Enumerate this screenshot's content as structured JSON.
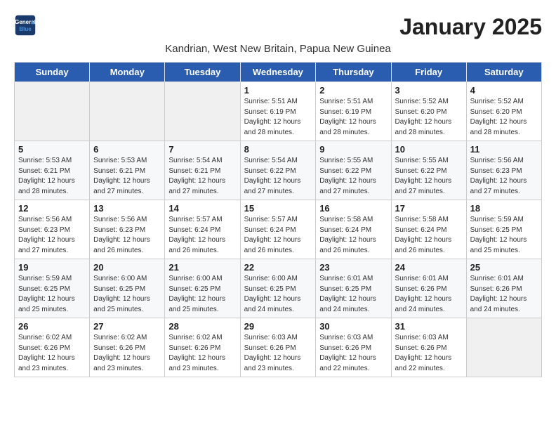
{
  "logo": {
    "line1": "General",
    "line2": "Blue"
  },
  "title": "January 2025",
  "subtitle": "Kandrian, West New Britain, Papua New Guinea",
  "days_of_week": [
    "Sunday",
    "Monday",
    "Tuesday",
    "Wednesday",
    "Thursday",
    "Friday",
    "Saturday"
  ],
  "weeks": [
    [
      {
        "day": "",
        "sunrise": "",
        "sunset": "",
        "daylight": ""
      },
      {
        "day": "",
        "sunrise": "",
        "sunset": "",
        "daylight": ""
      },
      {
        "day": "",
        "sunrise": "",
        "sunset": "",
        "daylight": ""
      },
      {
        "day": "1",
        "sunrise": "Sunrise: 5:51 AM",
        "sunset": "Sunset: 6:19 PM",
        "daylight": "Daylight: 12 hours and 28 minutes."
      },
      {
        "day": "2",
        "sunrise": "Sunrise: 5:51 AM",
        "sunset": "Sunset: 6:19 PM",
        "daylight": "Daylight: 12 hours and 28 minutes."
      },
      {
        "day": "3",
        "sunrise": "Sunrise: 5:52 AM",
        "sunset": "Sunset: 6:20 PM",
        "daylight": "Daylight: 12 hours and 28 minutes."
      },
      {
        "day": "4",
        "sunrise": "Sunrise: 5:52 AM",
        "sunset": "Sunset: 6:20 PM",
        "daylight": "Daylight: 12 hours and 28 minutes."
      }
    ],
    [
      {
        "day": "5",
        "sunrise": "Sunrise: 5:53 AM",
        "sunset": "Sunset: 6:21 PM",
        "daylight": "Daylight: 12 hours and 28 minutes."
      },
      {
        "day": "6",
        "sunrise": "Sunrise: 5:53 AM",
        "sunset": "Sunset: 6:21 PM",
        "daylight": "Daylight: 12 hours and 27 minutes."
      },
      {
        "day": "7",
        "sunrise": "Sunrise: 5:54 AM",
        "sunset": "Sunset: 6:21 PM",
        "daylight": "Daylight: 12 hours and 27 minutes."
      },
      {
        "day": "8",
        "sunrise": "Sunrise: 5:54 AM",
        "sunset": "Sunset: 6:22 PM",
        "daylight": "Daylight: 12 hours and 27 minutes."
      },
      {
        "day": "9",
        "sunrise": "Sunrise: 5:55 AM",
        "sunset": "Sunset: 6:22 PM",
        "daylight": "Daylight: 12 hours and 27 minutes."
      },
      {
        "day": "10",
        "sunrise": "Sunrise: 5:55 AM",
        "sunset": "Sunset: 6:22 PM",
        "daylight": "Daylight: 12 hours and 27 minutes."
      },
      {
        "day": "11",
        "sunrise": "Sunrise: 5:56 AM",
        "sunset": "Sunset: 6:23 PM",
        "daylight": "Daylight: 12 hours and 27 minutes."
      }
    ],
    [
      {
        "day": "12",
        "sunrise": "Sunrise: 5:56 AM",
        "sunset": "Sunset: 6:23 PM",
        "daylight": "Daylight: 12 hours and 27 minutes."
      },
      {
        "day": "13",
        "sunrise": "Sunrise: 5:56 AM",
        "sunset": "Sunset: 6:23 PM",
        "daylight": "Daylight: 12 hours and 26 minutes."
      },
      {
        "day": "14",
        "sunrise": "Sunrise: 5:57 AM",
        "sunset": "Sunset: 6:24 PM",
        "daylight": "Daylight: 12 hours and 26 minutes."
      },
      {
        "day": "15",
        "sunrise": "Sunrise: 5:57 AM",
        "sunset": "Sunset: 6:24 PM",
        "daylight": "Daylight: 12 hours and 26 minutes."
      },
      {
        "day": "16",
        "sunrise": "Sunrise: 5:58 AM",
        "sunset": "Sunset: 6:24 PM",
        "daylight": "Daylight: 12 hours and 26 minutes."
      },
      {
        "day": "17",
        "sunrise": "Sunrise: 5:58 AM",
        "sunset": "Sunset: 6:24 PM",
        "daylight": "Daylight: 12 hours and 26 minutes."
      },
      {
        "day": "18",
        "sunrise": "Sunrise: 5:59 AM",
        "sunset": "Sunset: 6:25 PM",
        "daylight": "Daylight: 12 hours and 25 minutes."
      }
    ],
    [
      {
        "day": "19",
        "sunrise": "Sunrise: 5:59 AM",
        "sunset": "Sunset: 6:25 PM",
        "daylight": "Daylight: 12 hours and 25 minutes."
      },
      {
        "day": "20",
        "sunrise": "Sunrise: 6:00 AM",
        "sunset": "Sunset: 6:25 PM",
        "daylight": "Daylight: 12 hours and 25 minutes."
      },
      {
        "day": "21",
        "sunrise": "Sunrise: 6:00 AM",
        "sunset": "Sunset: 6:25 PM",
        "daylight": "Daylight: 12 hours and 25 minutes."
      },
      {
        "day": "22",
        "sunrise": "Sunrise: 6:00 AM",
        "sunset": "Sunset: 6:25 PM",
        "daylight": "Daylight: 12 hours and 24 minutes."
      },
      {
        "day": "23",
        "sunrise": "Sunrise: 6:01 AM",
        "sunset": "Sunset: 6:25 PM",
        "daylight": "Daylight: 12 hours and 24 minutes."
      },
      {
        "day": "24",
        "sunrise": "Sunrise: 6:01 AM",
        "sunset": "Sunset: 6:26 PM",
        "daylight": "Daylight: 12 hours and 24 minutes."
      },
      {
        "day": "25",
        "sunrise": "Sunrise: 6:01 AM",
        "sunset": "Sunset: 6:26 PM",
        "daylight": "Daylight: 12 hours and 24 minutes."
      }
    ],
    [
      {
        "day": "26",
        "sunrise": "Sunrise: 6:02 AM",
        "sunset": "Sunset: 6:26 PM",
        "daylight": "Daylight: 12 hours and 23 minutes."
      },
      {
        "day": "27",
        "sunrise": "Sunrise: 6:02 AM",
        "sunset": "Sunset: 6:26 PM",
        "daylight": "Daylight: 12 hours and 23 minutes."
      },
      {
        "day": "28",
        "sunrise": "Sunrise: 6:02 AM",
        "sunset": "Sunset: 6:26 PM",
        "daylight": "Daylight: 12 hours and 23 minutes."
      },
      {
        "day": "29",
        "sunrise": "Sunrise: 6:03 AM",
        "sunset": "Sunset: 6:26 PM",
        "daylight": "Daylight: 12 hours and 23 minutes."
      },
      {
        "day": "30",
        "sunrise": "Sunrise: 6:03 AM",
        "sunset": "Sunset: 6:26 PM",
        "daylight": "Daylight: 12 hours and 22 minutes."
      },
      {
        "day": "31",
        "sunrise": "Sunrise: 6:03 AM",
        "sunset": "Sunset: 6:26 PM",
        "daylight": "Daylight: 12 hours and 22 minutes."
      },
      {
        "day": "",
        "sunrise": "",
        "sunset": "",
        "daylight": ""
      }
    ]
  ]
}
